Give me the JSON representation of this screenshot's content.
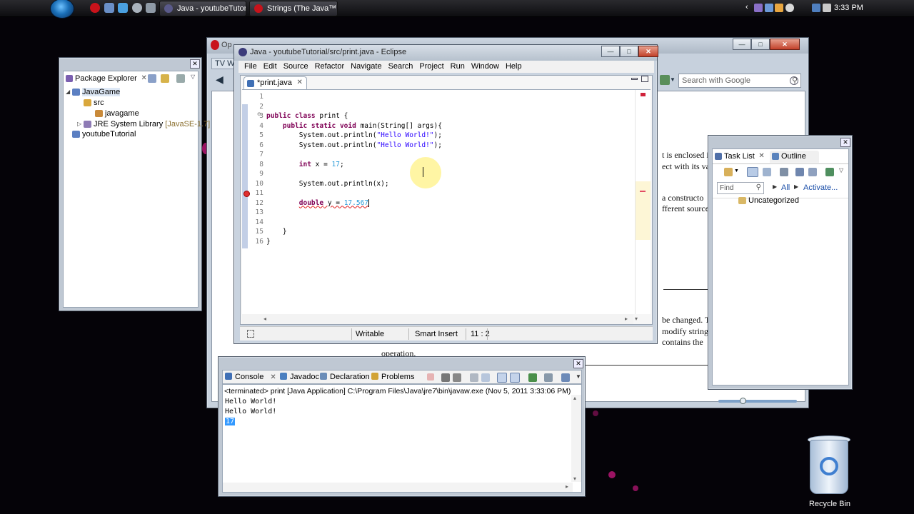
{
  "taskbar": {
    "buttons": [
      {
        "label": "Java - youtubeTutor..."
      },
      {
        "label": "Strings (The Java™ T..."
      }
    ],
    "clock": "3:33 PM"
  },
  "opera": {
    "logo_text": "Op",
    "tab_text": "TV Wa",
    "search_placeholder": "Search with Google",
    "page_text": [
      "t is enclosed in",
      "ect with its val",
      "a constructo",
      "fferent sources",
      "be changed. T",
      "modify strings",
      "contains the",
      "operation."
    ]
  },
  "eclipse": {
    "title": "Java - youtubeTutorial/src/print.java - Eclipse",
    "menu": [
      "File",
      "Edit",
      "Source",
      "Refactor",
      "Navigate",
      "Search",
      "Project",
      "Run",
      "Window",
      "Help"
    ],
    "editor_tab": "*print.java",
    "line_numbers": "1\n2\n3\n4\n5\n6\n7\n8\n9\n10\n11\n12\n13\n14\n15\n16",
    "code": {
      "l2_kw": "public class",
      "l2_rest": " print {",
      "l3_kw": "public static void",
      "l3_rest": " main(String[] args){",
      "l4_pre": "System.out.println(",
      "l4_str": "\"Hello World!\"",
      "l4_post": ");",
      "l5_pre": "System.out.println(",
      "l5_str": "\"Hello World!\"",
      "l5_post": ");",
      "l7_kw": "int",
      "l7_rest": " x = ",
      "l7_num": "17",
      "l7_end": ";",
      "l9": "System.out.println(x);",
      "l11_kw": "double",
      "l11_rest": " y = ",
      "l11_num": "17.567",
      "l14": "}",
      "l15": "}"
    },
    "status": {
      "writable": "Writable",
      "insert": "Smart Insert",
      "position": "11 : 2"
    }
  },
  "package_explorer": {
    "tab_label": "Package Explorer",
    "tree": [
      {
        "label": "JavaGame"
      },
      {
        "label": "src"
      },
      {
        "label": "javagame"
      },
      {
        "label": "JRE System Library",
        "suffix": "[JavaSE-1.7]"
      },
      {
        "label": "youtubeTutorial"
      }
    ]
  },
  "console": {
    "tabs": [
      "Console",
      "Javadoc",
      "Declaration",
      "Problems"
    ],
    "terminated": "<terminated> print [Java Application] C:\\Program Files\\Java\\jre7\\bin\\javaw.exe (Nov 5, 2011 3:33:06 PM)",
    "output": [
      "Hello World!",
      "Hello World!",
      "17"
    ]
  },
  "task_list": {
    "tabs": [
      "Task List",
      "Outline"
    ],
    "find_placeholder": "Find",
    "all_label": "All",
    "activate_label": "Activate...",
    "uncategorized": "Uncategorized"
  },
  "desktop": {
    "recycle_bin_label": "Recycle Bin"
  },
  "colors": {
    "keyword": "#7f0055",
    "string": "#2a00ff",
    "number": "#2a9bd8",
    "selection": "#3399ff"
  }
}
